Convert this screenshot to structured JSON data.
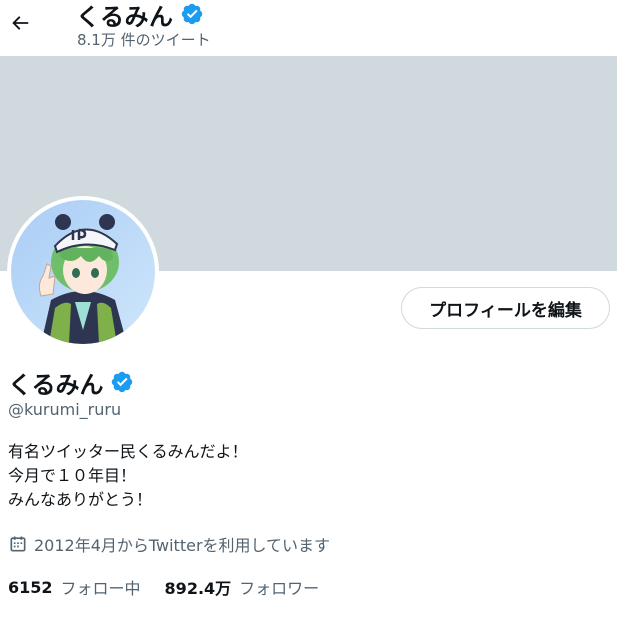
{
  "header": {
    "back_icon": "arrow-left-icon",
    "title": "くるみん",
    "tweet_count": "8.1万 件のツイート"
  },
  "profile": {
    "display_name": "くるみん",
    "handle": "@kurumi_ruru",
    "verified_icon": "verified-badge-icon",
    "bio": [
      "有名ツイッター民くるみんだよ！",
      "今月で１０年目！",
      "みんなありがとう！"
    ],
    "joined": "2012年4月からTwitterを利用しています",
    "joined_icon": "calendar-icon",
    "following_count": "6152",
    "following_label": "フォロー中",
    "followers_count": "892.4万",
    "followers_label": "フォロワー"
  },
  "actions": {
    "edit_profile_label": "プロフィールを編集"
  },
  "colors": {
    "banner": "#cfd9de",
    "verified": "#1d9bf0",
    "secondary_text": "#536471",
    "primary_text": "#0f1419"
  }
}
